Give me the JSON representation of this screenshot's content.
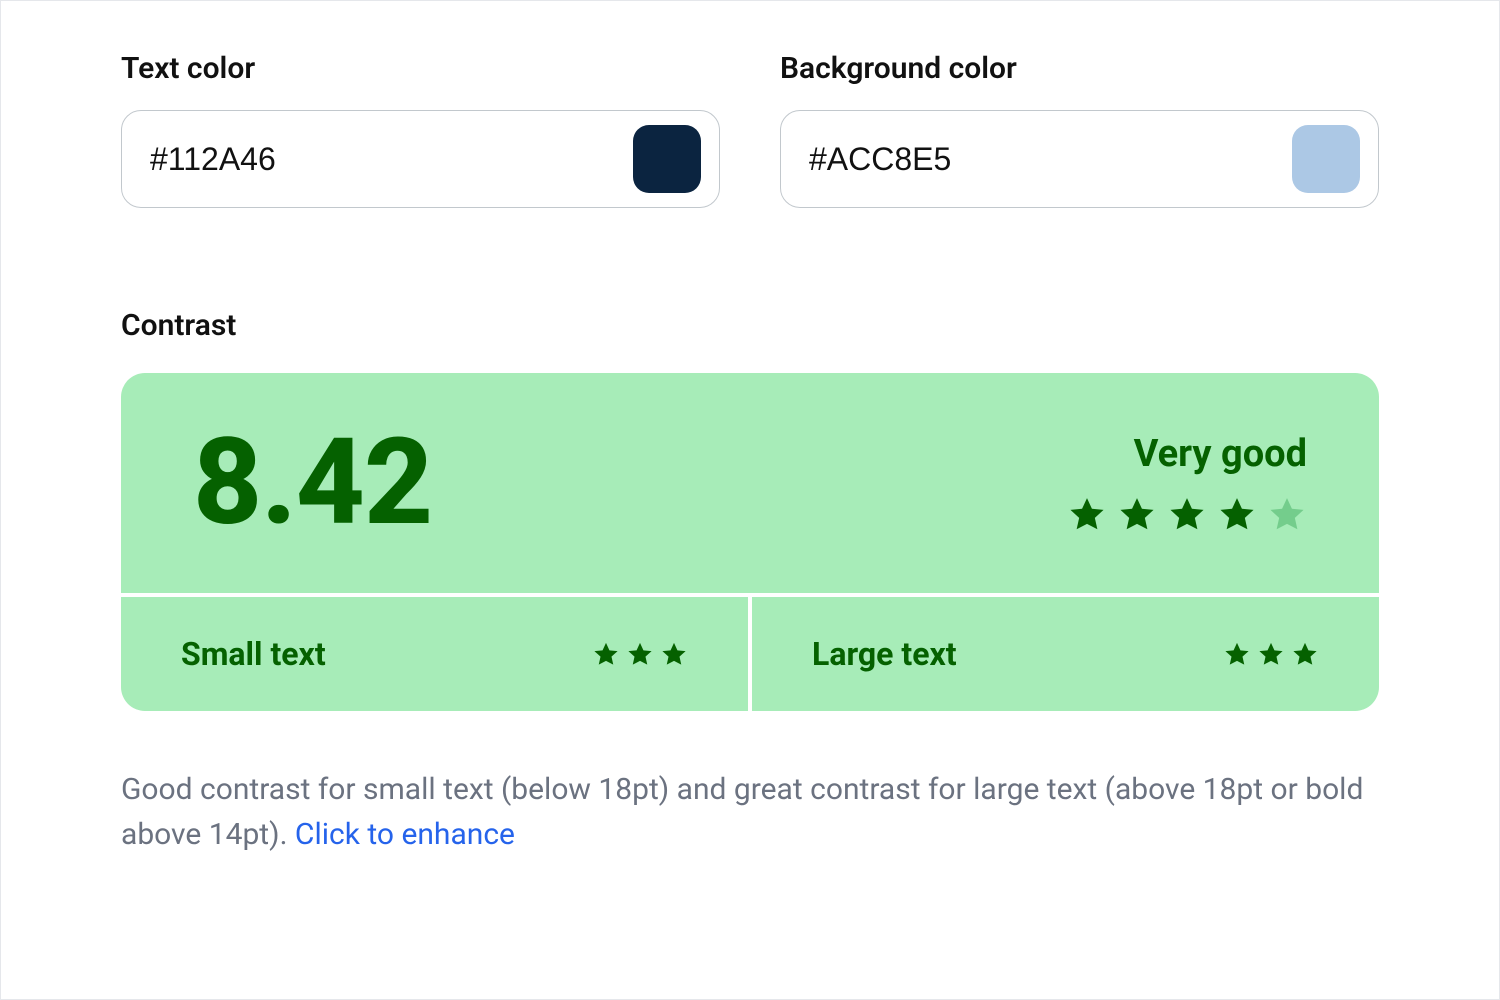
{
  "inputs": {
    "text_color": {
      "label": "Text color",
      "value": "#112A46",
      "swatch": "#0b2440"
    },
    "bg_color": {
      "label": "Background color",
      "value": "#ACC8E5",
      "swatch": "#acc8e5"
    }
  },
  "contrast": {
    "heading": "Contrast",
    "score": "8.42",
    "verdict": "Very good",
    "overall_stars": {
      "filled": 4,
      "total": 5
    },
    "small_text": {
      "label": "Small text",
      "stars": 3
    },
    "large_text": {
      "label": "Large text",
      "stars": 3
    }
  },
  "description": {
    "text": "Good contrast for small text (below 18pt) and great contrast for large text (above 18pt or bold above 14pt). ",
    "link": "Click to enhance"
  },
  "colors": {
    "card_bg": "#a7ecb8",
    "accent": "#056100",
    "dim_star": "#74cd8c"
  }
}
